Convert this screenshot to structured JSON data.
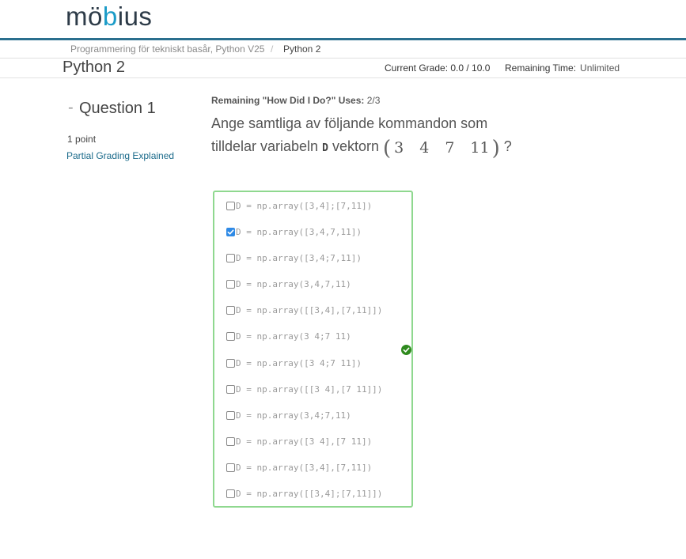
{
  "app": {
    "logo_text_before": "m",
    "logo_text_accent": "ö",
    "logo_text_mid": "b",
    "logo_text_accent2": "i",
    "logo_text_after": "us"
  },
  "breadcrumb": {
    "items": [
      "Programmering för tekniskt basår, Python V25",
      "Python 2"
    ],
    "separator": "/"
  },
  "header": {
    "title": "Python 2",
    "grade_label": "Current Grade: 0.0 / 10.0",
    "remaining_label": "Remaining Time:",
    "remaining_value": "Unlimited"
  },
  "question": {
    "dash": "-",
    "title": "Question 1",
    "points": "1 point",
    "partial_link": "Partial Grading Explained",
    "hdid_label": "Remaining \"How Did I Do?\" Uses:",
    "hdid_value": "2/3",
    "text_line1": "Ange samtliga av följande kommandon som",
    "text_line2_pre": "tilldelar variabeln",
    "text_var": "D",
    "text_line2_mid": "vektorn",
    "text_end": "?",
    "vector": [
      "3",
      "4",
      "7",
      "11"
    ],
    "paren_open": "(",
    "paren_close": ")"
  },
  "answers": {
    "options": [
      {
        "label": "D = np.array([3,4];[7,11])",
        "checked": false
      },
      {
        "label": "D = np.array([3,4,7,11])",
        "checked": true
      },
      {
        "label": "D = np.array([3,4;7,11])",
        "checked": false
      },
      {
        "label": "D = np.array(3,4,7,11)",
        "checked": false
      },
      {
        "label": "D = np.array([[3,4],[7,11]])",
        "checked": false
      },
      {
        "label": "D = np.array(3 4;7 11)",
        "checked": false
      },
      {
        "label": "D = np.array([3 4;7 11])",
        "checked": false
      },
      {
        "label": "D = np.array([[3 4],[7 11]])",
        "checked": false
      },
      {
        "label": "D = np.array(3,4;7,11)",
        "checked": false
      },
      {
        "label": "D = np.array([3 4],[7 11])",
        "checked": false
      },
      {
        "label": "D = np.array([3,4],[7,11])",
        "checked": false
      },
      {
        "label": "D = np.array([[3,4];[7,11]])",
        "checked": false
      }
    ],
    "status_icon": "check-circle-icon"
  },
  "colors": {
    "accent": "#2a6f8e",
    "logo_accent": "#1a9bc7",
    "correct_border": "#8fd88f",
    "checkbox_checked": "#2f8ae6",
    "correct_icon": "#2f8a1e"
  }
}
